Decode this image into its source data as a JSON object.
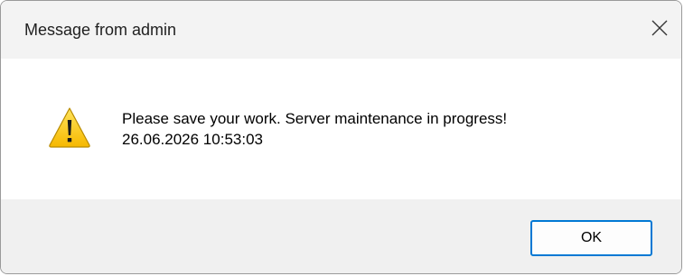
{
  "window": {
    "title": "Message from admin",
    "close_icon": "close-icon"
  },
  "message": {
    "icon": "warning-icon",
    "line1": "Please save your work. Server maintenance in progress!",
    "line2": "26.06.2026 10:53:03"
  },
  "buttons": {
    "ok_label": "OK"
  },
  "colors": {
    "accent": "#0078d4",
    "warning_yellow": "#ffd21f",
    "footer_bg": "#f0f0f0"
  }
}
